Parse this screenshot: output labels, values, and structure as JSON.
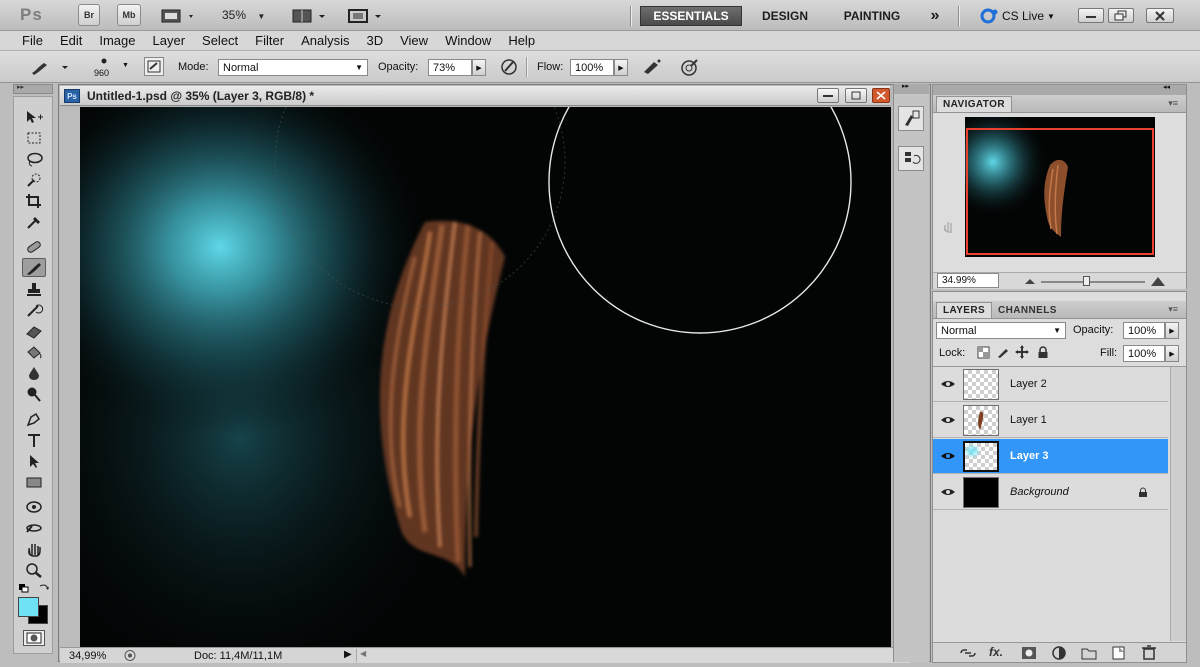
{
  "app": {
    "logo": "Ps",
    "bridge_label": "Br",
    "minibridge_label": "Mb",
    "zoom_label": "35%",
    "workspaces": [
      "ESSENTIALS",
      "DESIGN",
      "PAINTING"
    ],
    "more_workspaces": "»",
    "cs_live": "CS Live"
  },
  "menu": [
    "File",
    "Edit",
    "Image",
    "Layer",
    "Select",
    "Filter",
    "Analysis",
    "3D",
    "View",
    "Window",
    "Help"
  ],
  "options": {
    "brush_size": "960",
    "mode_label": "Mode:",
    "mode_value": "Normal",
    "opacity_label": "Opacity:",
    "opacity_value": "73%",
    "flow_label": "Flow:",
    "flow_value": "100%"
  },
  "document": {
    "tab_title": "Untitled-1.psd @ 35% (Layer 3, RGB/8) *",
    "zoom": "34,99%",
    "doc_info": "Doc: 11,4M/11,1M"
  },
  "colors": {
    "foreground": "#6fe3f5",
    "background": "#000000",
    "glow": "#5bd6e6",
    "hair": "#a5613a",
    "selection": "#3196f7",
    "navigator_box": "#e8412e"
  },
  "navigator": {
    "title": "NAVIGATOR",
    "zoom": "34.99%",
    "zoom_slider_level": 0.45
  },
  "layers_panel": {
    "tabs": [
      "LAYERS",
      "CHANNELS"
    ],
    "blend_mode": "Normal",
    "opacity_label": "Opacity:",
    "opacity_value": "100%",
    "lock_label": "Lock:",
    "fill_label": "Fill:",
    "fill_value": "100%",
    "layers": [
      {
        "name": "Layer 2",
        "selected": false
      },
      {
        "name": "Layer 1",
        "selected": false
      },
      {
        "name": "Layer 3",
        "selected": true
      },
      {
        "name": "Background",
        "selected": false,
        "locked": true
      }
    ]
  }
}
